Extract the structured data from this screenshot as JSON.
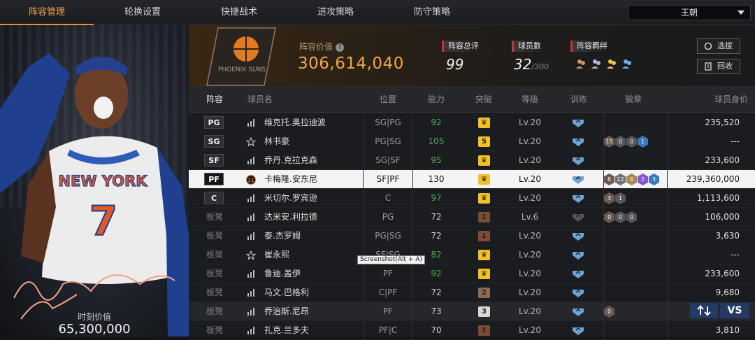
{
  "tabs": [
    {
      "label": "阵容管理",
      "active": true
    },
    {
      "label": "轮换设置"
    },
    {
      "label": "快捷战术"
    },
    {
      "label": "进攻策略"
    },
    {
      "label": "防守策略"
    }
  ],
  "team_select": {
    "value": "王朝"
  },
  "featured_player": {
    "jersey_text": "NEW YORK",
    "number": "7",
    "value_label": "时刻价值",
    "value": "65,300,000"
  },
  "header": {
    "lineup_value_label": "阵容价值",
    "lineup_value": "306,614,040",
    "overall_label": "阵容总评",
    "overall": "99",
    "player_count_label": "球员数",
    "player_count": "32",
    "player_count_max": "/300",
    "bond_label": "阵容羁绊",
    "select_btn": "选拔",
    "recycle_btn": "回收",
    "team_logo_text": "PHOENIX SUNS"
  },
  "columns": [
    "阵容",
    "球员名",
    "位置",
    "能力",
    "突破",
    "等级",
    "训练",
    "徽章",
    "球员身价"
  ],
  "rows": [
    {
      "slot": "PG",
      "name": "维克托.奥拉迪波",
      "pos": "SG|PG",
      "ability": "92",
      "breakthrough": "",
      "level": "Lv.20",
      "badges": [],
      "price": "235,520",
      "icon": "bars"
    },
    {
      "slot": "SG",
      "name": "林书豪",
      "pos": "PG|SG",
      "ability": "105",
      "breakthrough": "5",
      "level": "Lv.20",
      "badges": [
        "15",
        "0",
        "0",
        "1"
      ],
      "price": "---",
      "icon": "star"
    },
    {
      "slot": "SF",
      "name": "乔丹.克拉克森",
      "pos": "SG|SF",
      "ability": "95",
      "breakthrough": "",
      "level": "Lv.20",
      "badges": [],
      "price": "233,600",
      "icon": "bars"
    },
    {
      "slot": "PF",
      "name": "卡梅隆.安东尼",
      "pos": "SF|PF",
      "ability": "130",
      "breakthrough": "",
      "level": "Lv.20",
      "badges": [
        "8",
        "22",
        "6",
        "2",
        "3"
      ],
      "price": "239,360,000",
      "icon": "11",
      "highlight": true
    },
    {
      "slot": "C",
      "name": "米切尔.罗宾逊",
      "pos": "C",
      "ability": "97",
      "breakthrough": "",
      "level": "Lv.20",
      "badges": [
        "3",
        "1"
      ],
      "price": "1,113,600",
      "icon": "bars"
    },
    {
      "slot": "板凳",
      "name": "达米安.利拉德",
      "pos": "PG",
      "ability": "72",
      "breakthrough": "1",
      "level": "Lv.6",
      "badges": [
        "0",
        "0",
        "0"
      ],
      "price": "106,000",
      "icon": "bars"
    },
    {
      "slot": "板凳",
      "name": "泰.杰罗姆",
      "pos": "PG|SG",
      "ability": "72",
      "breakthrough": "1",
      "level": "Lv.20",
      "badges": [],
      "price": "3,630",
      "icon": "bars"
    },
    {
      "slot": "板凳",
      "name": "崔永熙",
      "pos": "SF|SG",
      "ability": "82",
      "breakthrough": "",
      "level": "Lv.20",
      "badges": [],
      "price": "---",
      "icon": "star"
    },
    {
      "slot": "板凳",
      "name": "鲁迪.盖伊",
      "pos": "PF",
      "ability": "92",
      "breakthrough": "",
      "level": "Lv.20",
      "badges": [],
      "price": "233,600",
      "icon": "bars"
    },
    {
      "slot": "板凳",
      "name": "马文.巴格利",
      "pos": "C|PF",
      "ability": "72",
      "breakthrough": "2",
      "level": "Lv.20",
      "badges": [],
      "price": "9,680",
      "icon": "bars"
    },
    {
      "slot": "板凳",
      "name": "乔治斯.尼昂",
      "pos": "PF",
      "ability": "73",
      "breakthrough": "3",
      "level": "Lv.20",
      "badges": [
        "0"
      ],
      "price": "",
      "icon": "bars",
      "alt": true
    },
    {
      "slot": "板凳",
      "name": "扎克.兰多夫",
      "pos": "PF|C",
      "ability": "70",
      "breakthrough": "1",
      "level": "Lv.20",
      "badges": [],
      "price": "3,810",
      "icon": "bars"
    }
  ],
  "tooltip": "Screenshot(Alt + A)",
  "vs_btn": "VS",
  "colors": {
    "accent": "#f0a64a",
    "ability_green": "#4caf4c",
    "badge_colors": [
      "#6b5a52",
      "#6f6f72",
      "#a58a4e",
      "#8855d4",
      "#3a78c2"
    ]
  }
}
